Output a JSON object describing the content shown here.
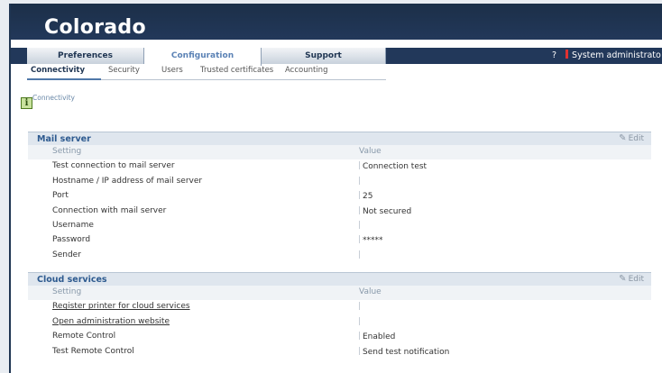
{
  "app": {
    "brand": "Colorado"
  },
  "tabs": [
    {
      "label": "Preferences"
    },
    {
      "label": "Configuration"
    },
    {
      "label": "Support"
    }
  ],
  "user": {
    "help": "?",
    "name": "System administrato"
  },
  "subnav": [
    {
      "label": "Connectivity"
    },
    {
      "label": "Security"
    },
    {
      "label": "Users"
    },
    {
      "label": "Trusted certificates"
    },
    {
      "label": "Accounting"
    }
  ],
  "breadcrumb": "Connectivity",
  "info_icon": "i",
  "columns": {
    "setting": "Setting",
    "value": "Value"
  },
  "edit_label": "Edit",
  "mail": {
    "title": "Mail server",
    "rows": [
      {
        "setting": "Test connection to mail server",
        "value": "Connection test"
      },
      {
        "setting": "Hostname / IP address of mail server",
        "value": ""
      },
      {
        "setting": "Port",
        "value": "25"
      },
      {
        "setting": "Connection with mail server",
        "value": "Not secured"
      },
      {
        "setting": "Username",
        "value": ""
      },
      {
        "setting": "Password",
        "value": "*****"
      },
      {
        "setting": "Sender",
        "value": ""
      }
    ]
  },
  "cloud": {
    "title": "Cloud services",
    "rows": [
      {
        "setting": "Register printer for cloud services",
        "value": ""
      },
      {
        "setting": "Open administration website",
        "value": ""
      },
      {
        "setting": "Remote Control",
        "value": "Enabled"
      },
      {
        "setting": "Test Remote Control",
        "value": "Send test notification"
      }
    ]
  }
}
